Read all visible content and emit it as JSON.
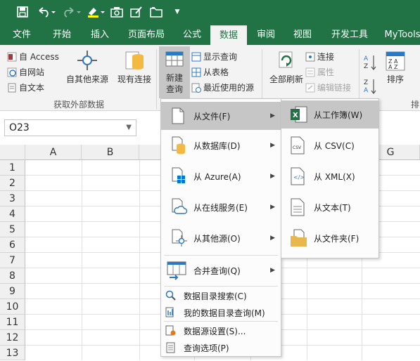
{
  "qat": {
    "save": "save-icon",
    "undo": "undo-icon",
    "redo": "redo-icon"
  },
  "tabs": [
    "文件",
    "开始",
    "插入",
    "页面布局",
    "公式",
    "数据",
    "审阅",
    "视图",
    "开发工具",
    "MyTools"
  ],
  "active_tab": "数据",
  "ribbon": {
    "external": {
      "from_access": "自 Access",
      "from_web": "自网站",
      "from_text": "自文本",
      "from_other": "自其他来源",
      "existing": "现有连接",
      "group_label": "获取外部数据"
    },
    "query": {
      "new_query_1": "新建",
      "new_query_2": "查询",
      "show_queries": "显示查询",
      "from_table": "从表格",
      "recent_sources": "最近使用的源"
    },
    "connections": {
      "refresh_1": "全部刷新",
      "connections": "连接",
      "properties": "属性",
      "edit_links": "编辑链接"
    },
    "sort": {
      "sort_label": "排序",
      "group_partial": "排"
    }
  },
  "namebox": "O23",
  "columns": [
    "A",
    "B",
    "G"
  ],
  "rows": [
    "1",
    "2",
    "3",
    "4",
    "5",
    "6",
    "7",
    "8",
    "9",
    "10",
    "11",
    "12",
    "13"
  ],
  "new_query_menu": [
    {
      "label": "从文件(F)",
      "submenu": true,
      "highlighted": true
    },
    {
      "label": "从数据库(D)",
      "submenu": true
    },
    {
      "label": "从 Azure(A)",
      "submenu": true
    },
    {
      "label": "从在线服务(E)",
      "submenu": true
    },
    {
      "label": "从其他源(O)",
      "submenu": true
    },
    {
      "label": "合并查询(Q)",
      "submenu": true
    },
    {
      "label": "数据目录搜索(C)"
    },
    {
      "label": "我的数据目录查询(M)"
    },
    {
      "label": "数据源设置(S)..."
    },
    {
      "label": "查询选项(P)"
    }
  ],
  "from_file_submenu": [
    {
      "label": "从工作簿(W)",
      "highlighted": true
    },
    {
      "label": "从 CSV(C)"
    },
    {
      "label": "从 XML(X)"
    },
    {
      "label": "从文本(T)"
    },
    {
      "label": "从文件夹(F)"
    }
  ],
  "colors": {
    "excel_green": "#217346",
    "ribbon_bg": "#f3f3f3",
    "menu_highlight": "#c6c6c6"
  }
}
